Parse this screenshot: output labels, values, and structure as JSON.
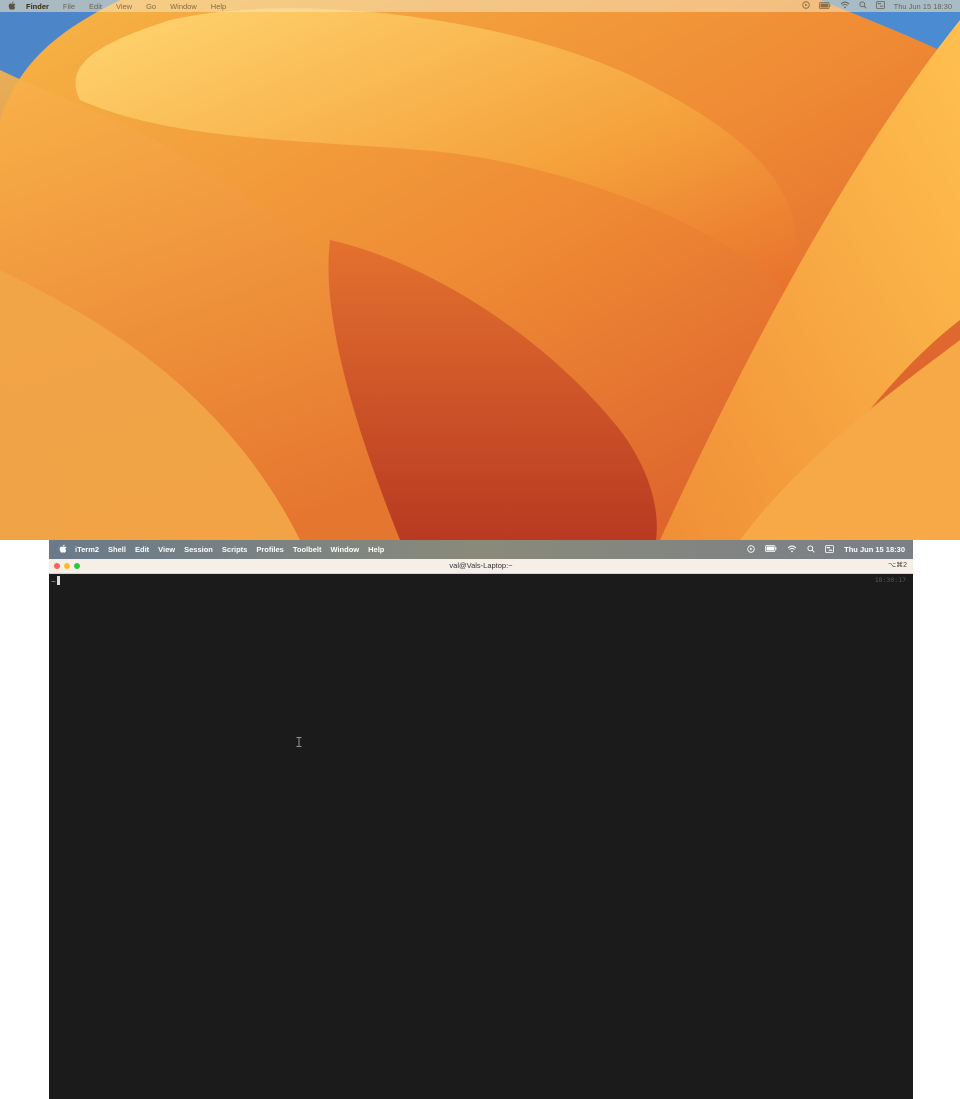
{
  "top_menubar": {
    "app_name": "Finder",
    "menus": [
      "File",
      "Edit",
      "View",
      "Go",
      "Window",
      "Help"
    ],
    "clock": "Thu Jun 15  18:30",
    "status_icons": [
      "play-circle-icon",
      "battery-icon",
      "wifi-icon",
      "search-icon",
      "control-center-icon"
    ]
  },
  "bottom_menubar": {
    "app_name": "iTerm2",
    "menus": [
      "Shell",
      "Edit",
      "View",
      "Session",
      "Scripts",
      "Profiles",
      "Toolbelt",
      "Window",
      "Help"
    ],
    "clock": "Thu Jun 15  18:30",
    "status_icons": [
      "play-circle-icon",
      "battery-icon",
      "wifi-icon",
      "search-icon",
      "control-center-icon"
    ]
  },
  "terminal_window": {
    "title": "val@Vals-Laptop:~",
    "shortcut": "⌥⌘2",
    "prompt": "~",
    "timestamp": "18:30:17"
  },
  "colors": {
    "terminal_background": "#1b1b1b",
    "close": "#fe5f57",
    "minimize": "#febc2e",
    "zoom": "#28c840"
  }
}
